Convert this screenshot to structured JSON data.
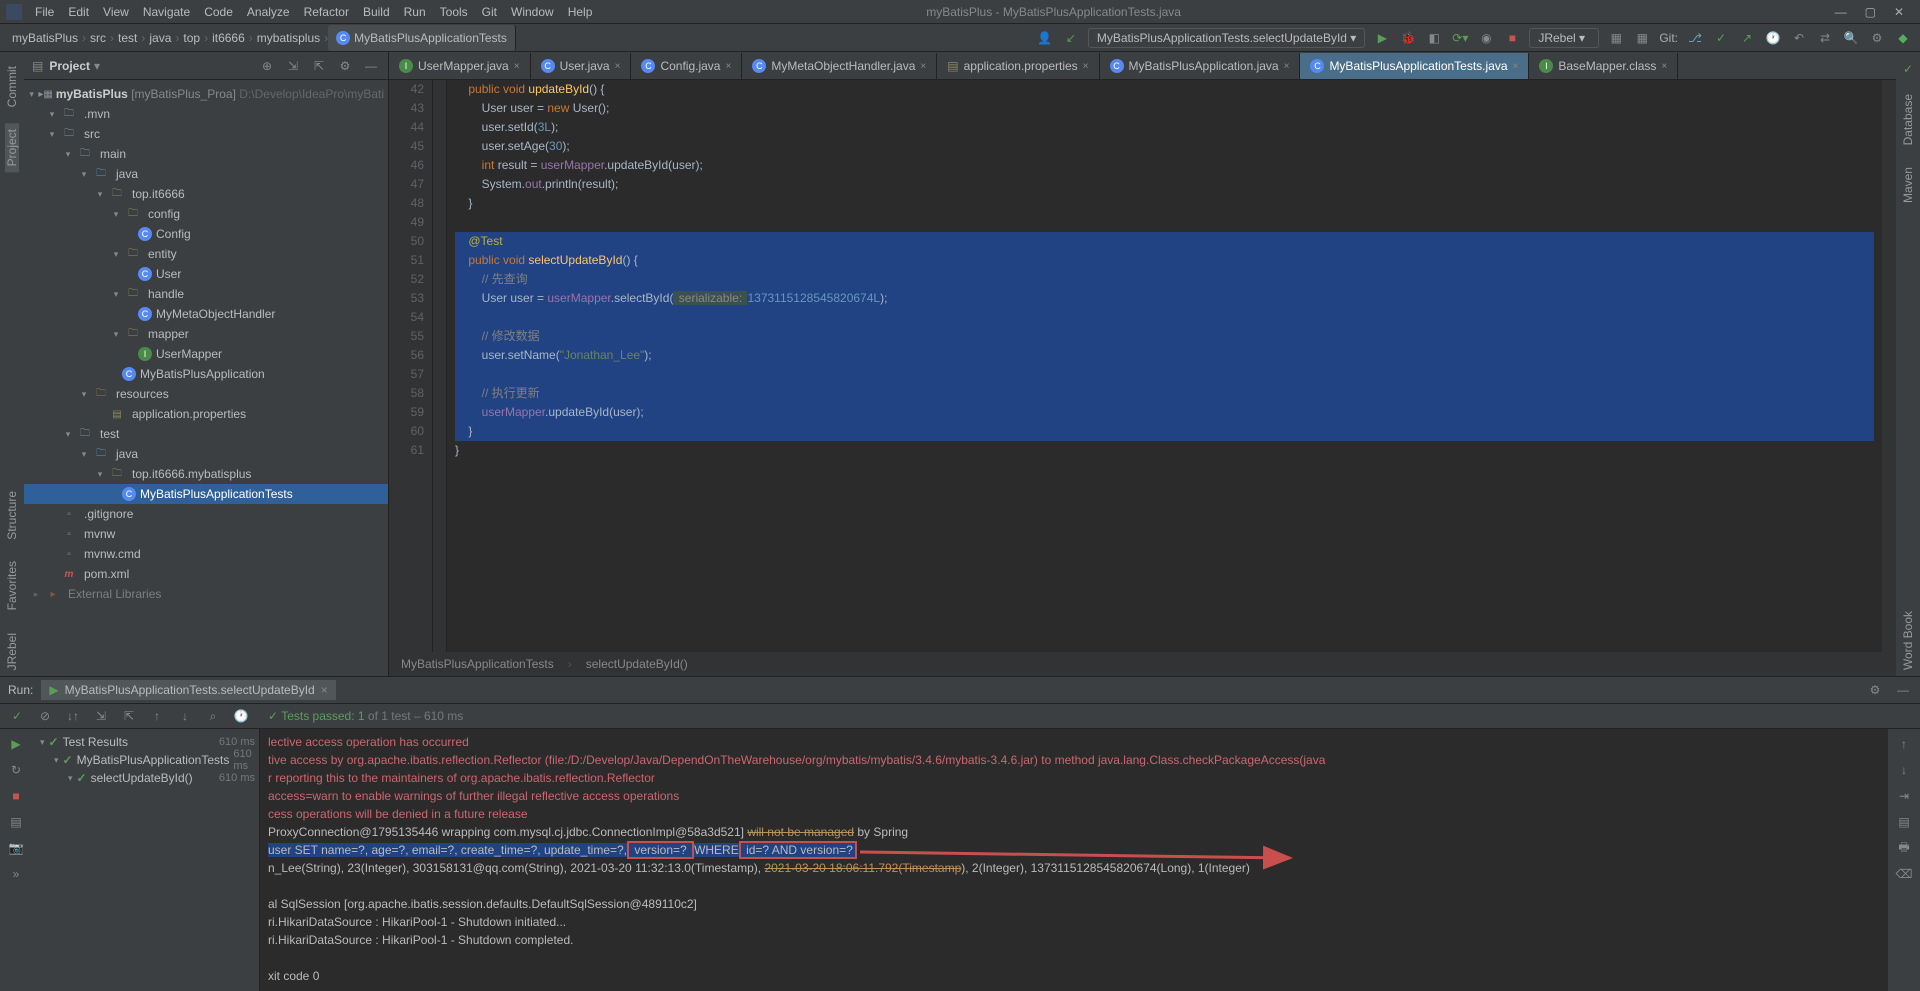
{
  "window": {
    "title": "myBatisPlus - MyBatisPlusApplicationTests.java"
  },
  "menu": [
    "File",
    "Edit",
    "View",
    "Navigate",
    "Code",
    "Analyze",
    "Refactor",
    "Build",
    "Run",
    "Tools",
    "Git",
    "Window",
    "Help"
  ],
  "breadcrumbs": [
    "myBatisPlus",
    "src",
    "test",
    "java",
    "top",
    "it6666",
    "mybatisplus",
    "MyBatisPlusApplicationTests"
  ],
  "toolbar": {
    "runconfig": "MyBatisPlusApplicationTests.selectUpdateById",
    "jrebel": "JRebel",
    "git": "Git:"
  },
  "projectPanel": {
    "title": "Project",
    "root": {
      "name": "myBatisPlus",
      "suffix": "[myBatisPlus_Proa]",
      "path": "D:\\Develop\\IdeaPro\\myBati"
    },
    "tree": [
      {
        "d": 1,
        "a": "v",
        "i": "folder",
        "t": ".mvn"
      },
      {
        "d": 1,
        "a": "v",
        "i": "folder",
        "t": "src"
      },
      {
        "d": 2,
        "a": "v",
        "i": "folder",
        "t": "main"
      },
      {
        "d": 3,
        "a": "v",
        "i": "java-f",
        "t": "java"
      },
      {
        "d": 4,
        "a": "v",
        "i": "pkg",
        "t": "top.it6666"
      },
      {
        "d": 5,
        "a": "v",
        "i": "pkg",
        "t": "config"
      },
      {
        "d": 6,
        "a": "",
        "i": "class",
        "t": "Config"
      },
      {
        "d": 5,
        "a": "v",
        "i": "pkg",
        "t": "entity"
      },
      {
        "d": 6,
        "a": "",
        "i": "class",
        "t": "User"
      },
      {
        "d": 5,
        "a": "v",
        "i": "pkg",
        "t": "handle"
      },
      {
        "d": 6,
        "a": "",
        "i": "class",
        "t": "MyMetaObjectHandler"
      },
      {
        "d": 5,
        "a": "v",
        "i": "pkg",
        "t": "mapper"
      },
      {
        "d": 6,
        "a": "",
        "i": "iface",
        "t": "UserMapper"
      },
      {
        "d": 5,
        "a": "",
        "i": "class",
        "t": "MyBatisPlusApplication"
      },
      {
        "d": 3,
        "a": "v",
        "i": "res",
        "t": "resources"
      },
      {
        "d": 4,
        "a": "",
        "i": "prop",
        "t": "application.properties"
      },
      {
        "d": 2,
        "a": "v",
        "i": "folder",
        "t": "test"
      },
      {
        "d": 3,
        "a": "v",
        "i": "java-f",
        "t": "java"
      },
      {
        "d": 4,
        "a": "v",
        "i": "pkg",
        "t": "top.it6666.mybatisplus"
      },
      {
        "d": 5,
        "a": "",
        "i": "class",
        "t": "MyBatisPlusApplicationTests",
        "sel": true
      },
      {
        "d": 1,
        "a": "",
        "i": "file",
        "t": ".gitignore"
      },
      {
        "d": 1,
        "a": "",
        "i": "file",
        "t": "mvnw"
      },
      {
        "d": 1,
        "a": "",
        "i": "file",
        "t": "mvnw.cmd"
      },
      {
        "d": 1,
        "a": "",
        "i": "m",
        "t": "pom.xml"
      },
      {
        "d": 0,
        "a": ">",
        "i": "lib",
        "t": "External Libraries",
        "dim": true
      }
    ]
  },
  "editor": {
    "tabs": [
      {
        "icon": "iface",
        "label": "UserMapper.java"
      },
      {
        "icon": "class",
        "label": "User.java"
      },
      {
        "icon": "class",
        "label": "Config.java"
      },
      {
        "icon": "class",
        "label": "MyMetaObjectHandler.java"
      },
      {
        "icon": "prop",
        "label": "application.properties"
      },
      {
        "icon": "class",
        "label": "MyBatisPlusApplication.java"
      },
      {
        "icon": "class",
        "label": "MyBatisPlusApplicationTests.java",
        "active": true
      },
      {
        "icon": "iface",
        "label": "BaseMapper.class"
      }
    ],
    "lines": [
      {
        "n": 42,
        "html": "    <span class='kw'>public void</span> <span class='id2'>updateById</span>() {"
      },
      {
        "n": 43,
        "html": "        User user = <span class='kw'>new</span> User();"
      },
      {
        "n": 44,
        "html": "        user.setId(<span class='num'>3L</span>);"
      },
      {
        "n": 45,
        "html": "        user.setAge(<span class='num'>30</span>);"
      },
      {
        "n": 46,
        "html": "        <span class='kw'>int</span> result = <span class='fld'>userMapper</span>.updateById(user);"
      },
      {
        "n": 47,
        "html": "        System.<span class='fld'>out</span>.println(result);"
      },
      {
        "n": 48,
        "html": "    }"
      },
      {
        "n": 49,
        "html": ""
      },
      {
        "n": 50,
        "html": "<span class='seltext'>    <span class='ann'>@Test</span></span>",
        "sel": true
      },
      {
        "n": 51,
        "html": "<span class='seltext'>    <span class='kw'>public void</span> <span class='id2'>selectUpdateById</span>() {</span>",
        "sel": true
      },
      {
        "n": 52,
        "html": "<span class='seltext'>        <span class='cmt'>// 先查询</span></span>",
        "sel": true
      },
      {
        "n": 53,
        "html": "<span class='seltext'>        User user = <span class='fld'>userMapper</span>.selectById(<span style='background:#3b514d;color:#888;padding:0 2px'> serializable: </span><span class='num'>1373115128545820674L</span>);</span>",
        "sel": true
      },
      {
        "n": 54,
        "html": "<span class='seltext'> </span>",
        "sel": true
      },
      {
        "n": 55,
        "html": "<span class='seltext'>        <span class='cmt'>// 修改数据</span></span>",
        "sel": true
      },
      {
        "n": 56,
        "html": "<span class='seltext'>        user.setName(<span class='str'>\"Jonathan_Lee\"</span>);</span>",
        "sel": true
      },
      {
        "n": 57,
        "html": "<span class='seltext'> </span>",
        "sel": true
      },
      {
        "n": 58,
        "html": "<span class='seltext'>        <span class='cmt'>// 执行更新</span></span>",
        "sel": true
      },
      {
        "n": 59,
        "html": "<span class='seltext'>        <span class='fld'>userMapper</span>.updateById(user);</span>",
        "sel": true
      },
      {
        "n": 60,
        "html": "<span class='seltext'>    }</span>",
        "sel": true
      },
      {
        "n": 61,
        "html": "}"
      }
    ],
    "crumbs": [
      "MyBatisPlusApplicationTests",
      "selectUpdateById()"
    ]
  },
  "run": {
    "label": "Run:",
    "tab": "MyBatisPlusApplicationTests.selectUpdateById",
    "status": "Tests passed: 1",
    "status2": "of 1 test – 610 ms",
    "tree": [
      {
        "d": 0,
        "t": "Test Results",
        "time": "610 ms"
      },
      {
        "d": 1,
        "t": "MyBatisPlusApplicationTests",
        "time": "610 ms"
      },
      {
        "d": 2,
        "t": "selectUpdateById()",
        "time": "610 ms"
      }
    ],
    "console": [
      {
        "cls": "err",
        "t": "lective access operation has occurred"
      },
      {
        "cls": "err",
        "t": "tive access by org.apache.ibatis.reflection.Reflector (file:/D:/Develop/Java/DependOnTheWarehouse/org/mybatis/mybatis/3.4.6/mybatis-3.4.6.jar) to method java.lang.Class.checkPackageAccess(java"
      },
      {
        "cls": "err",
        "t": "r reporting this to the maintainers of org.apache.ibatis.reflection.Reflector"
      },
      {
        "cls": "err",
        "t": "access=warn to enable warnings of further illegal reflective access operations"
      },
      {
        "cls": "err",
        "t": "cess operations will be denied in a future release"
      },
      {
        "cls": "",
        "html": "ProxyConnection@1795135446 wrapping com.mysql.cj.jdbc.ConnectionImpl@58a3d521] <span class='hl-orange strike'>will not be managed</span> by Spring"
      },
      {
        "cls": "",
        "html": "<span class='hl'>user SET name=?, age=?, email=?, create_time=?, update_time=?,</span><span class='redbox hl'> version=? </span><span class='hl'>WHERE</span><span class='redbox hl'> id=? AND version=?</span>"
      },
      {
        "cls": "",
        "html": "n_Lee(String), 23(Integer), 303158131@qq.com(String), 2021-03-20 11:32:13.0(Timestamp), <span class='hl-orange strike'>2021-03-20 18:06:11.792(Timestamp</span>), 2(Integer), 1373115128545820674(Long), 1(Integer)"
      },
      {
        "cls": "",
        "t": ""
      },
      {
        "cls": "",
        "t": "al SqlSession [org.apache.ibatis.session.defaults.DefaultSqlSession@489110c2]"
      },
      {
        "cls": "",
        "t": "ri.HikariDataSource                                               : HikariPool-1 - Shutdown initiated..."
      },
      {
        "cls": "",
        "t": "ri.HikariDataSource                                               : HikariPool-1 - Shutdown completed."
      },
      {
        "cls": "",
        "t": ""
      },
      {
        "cls": "",
        "t": "xit code 0"
      }
    ]
  },
  "leftTools": [
    "Commit",
    "Project"
  ],
  "leftToolsB": [
    "Structure",
    "Favorites",
    "JRebel"
  ],
  "rightTools": [
    "Database",
    "Maven",
    "Word Book"
  ]
}
